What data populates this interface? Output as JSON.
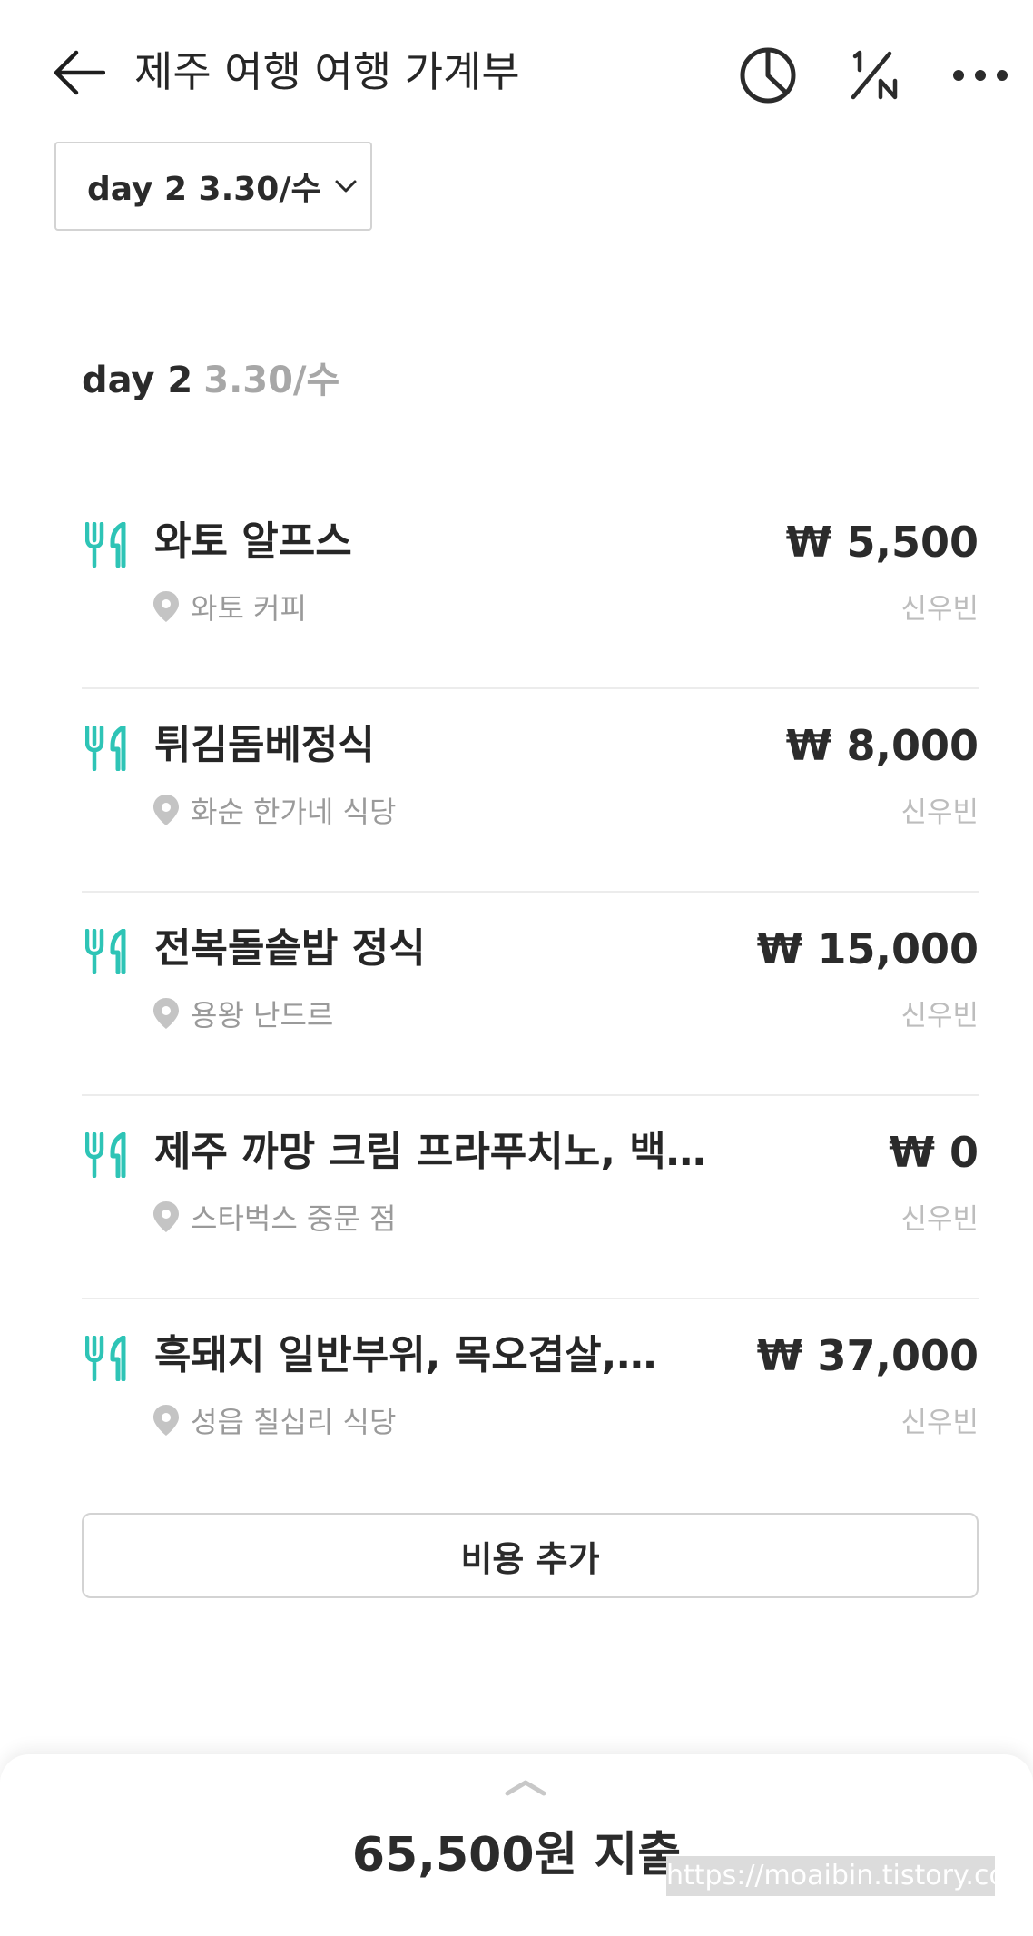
{
  "header": {
    "title": "제주 여행 여행 가계부",
    "back_icon": "arrow-left-icon",
    "chart_icon": "pie-chart-icon",
    "split_icon": "one-over-n-icon",
    "more_icon": "more-horizontal-icon"
  },
  "day_selector": {
    "value": "day 2 3.30/수"
  },
  "day_heading": {
    "day": "day 2",
    "date": "3.30/수"
  },
  "expenses": [
    {
      "name": "와토 알프스",
      "place": "와토 커피",
      "amount": "₩ 5,500",
      "payer": "신우빈",
      "category_icon": "fork-knife-icon"
    },
    {
      "name": "튀김돔베정식",
      "place": "화순 한가네 식당",
      "amount": "₩ 8,000",
      "payer": "신우빈",
      "category_icon": "fork-knife-icon"
    },
    {
      "name": "전복돌솥밥 정식",
      "place": "용왕 난드르",
      "amount": "₩ 15,000",
      "payer": "신우빈",
      "category_icon": "fork-knife-icon"
    },
    {
      "name": "제주 까망 크림 프라푸치노, 백년초콜릿 크림 프라푸치노",
      "place": "스타벅스 중문 점",
      "amount": "₩ 0",
      "payer": "신우빈",
      "category_icon": "fork-knife-icon"
    },
    {
      "name": "흑돼지 일반부위, 목오겹살, 볶음밥",
      "place": "성읍 칠십리 식당",
      "amount": "₩ 37,000",
      "payer": "신우빈",
      "category_icon": "fork-knife-icon"
    }
  ],
  "add_button": {
    "label": "비용 추가"
  },
  "summary": {
    "total": "65,500원 지출",
    "handle_icon": "chevron-up-icon"
  },
  "watermark": "https://moaibin.tistory.com",
  "colors": {
    "accent": "#2ec4b6",
    "text": "#2b2b2b",
    "muted": "#9a9a9a",
    "payer": "#bdbdbd",
    "divider": "#ececec"
  }
}
